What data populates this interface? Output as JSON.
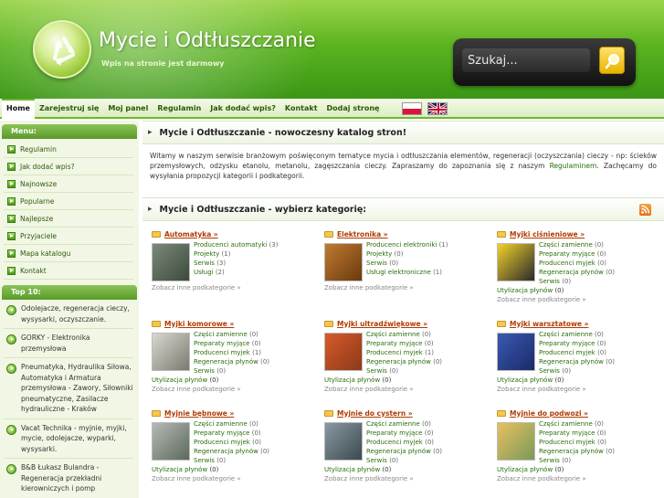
{
  "header": {
    "title": "Mycie i Odtłuszczanie",
    "subtitle": "Wpis na stronie jest darmowy",
    "search_placeholder": "Szukaj..."
  },
  "nav": {
    "items": [
      {
        "label": "Home"
      },
      {
        "label": "Zarejestruj się"
      },
      {
        "label": "Moj panel"
      },
      {
        "label": "Regulamin"
      },
      {
        "label": "Jak dodać wpis?"
      },
      {
        "label": "Kontakt"
      },
      {
        "label": "Dodaj stronę"
      }
    ]
  },
  "sidebar": {
    "menu_title": "Menu:",
    "menu": [
      {
        "label": "Regulamin"
      },
      {
        "label": "Jak dodać wpis?"
      },
      {
        "label": "Najnowsze"
      },
      {
        "label": "Popularne"
      },
      {
        "label": "Najlepsze"
      },
      {
        "label": "Przyjaciele"
      },
      {
        "label": "Mapa katalogu"
      },
      {
        "label": "Kontakt"
      }
    ],
    "top_title": "Top 10:",
    "top": [
      {
        "label": "Odolejacze, regeneracja cieczy, wysysarki, oczyszczanie."
      },
      {
        "label": "GORKY - Elektronika przemysłowa"
      },
      {
        "label": "Pneumatyka, Hydraulika Siłowa, Automatyka i Armatura przemysłowa - Zawory, Siłowniki pneumatyczne, Zasilacze hydrauliczne - Kraków"
      },
      {
        "label": "Vacat Technika - myjnie, myjki, mycie, odolejacze, wyparki, wysysarki."
      },
      {
        "label": "B&B Łukasz Bulandra - Regeneracja przekładni kierowniczych i pomp"
      }
    ]
  },
  "main": {
    "intro_title": "Mycie i Odtłuszczanie - nowoczesny katalog stron!",
    "intro_text_a": "Witamy w naszym serwisie branżowym poświęconym tematyce mycia i odtłuszczania elementów, regeneracji (oczyszczania) cieczy - np: ścieków przemysłowych, odzysku etanolu, metanolu, zagęszczania cieczy. Zapraszamy do zapoznania się z naszym ",
    "intro_link": "Regulaminem",
    "intro_text_b": ". Zachęcamy do wysyłania propozycji kategorii i podkategorii.",
    "cats_title": "Mycie i Odtłuszczanie - wybierz kategorię:",
    "more_label": "Zobacz inne podkategorie »",
    "categories": [
      {
        "title": "Automatyka »",
        "subs": [
          [
            "Producenci automatyki",
            "(3)"
          ],
          [
            "Projekty",
            "(1)"
          ],
          [
            "Serwis",
            "(3)"
          ],
          [
            "Usługi",
            "(2)"
          ]
        ],
        "after": []
      },
      {
        "title": "Elektronika »",
        "subs": [
          [
            "Producenci elektroniki",
            "(1)"
          ],
          [
            "Projekty",
            "(0)"
          ],
          [
            "Serwis",
            "(0)"
          ],
          [
            "Usługi elektroniczne",
            "(1)"
          ]
        ],
        "after": []
      },
      {
        "title": "Myjki ciśnieniowe »",
        "subs": [
          [
            "Części zamienne",
            "(0)"
          ],
          [
            "Preparaty myjące",
            "(0)"
          ],
          [
            "Producenci myjek",
            "(0)"
          ],
          [
            "Regeneracja płynów",
            "(0)"
          ],
          [
            "Serwis",
            "(0)"
          ]
        ],
        "after": [
          [
            "Utylizacja płynów",
            "(0)"
          ]
        ]
      },
      {
        "title": "Myjki komorowe »",
        "subs": [
          [
            "Części zamienne",
            "(0)"
          ],
          [
            "Preparaty myjące",
            "(0)"
          ],
          [
            "Producenci myjek",
            "(1)"
          ],
          [
            "Regeneracja płynów",
            "(0)"
          ],
          [
            "Serwis",
            "(0)"
          ]
        ],
        "after": [
          [
            "Utylizacja płynów",
            "(0)"
          ]
        ]
      },
      {
        "title": "Myjki ultradźwiękowe »",
        "subs": [
          [
            "Części zamienne",
            "(0)"
          ],
          [
            "Preparaty myjące",
            "(0)"
          ],
          [
            "Producenci myjek",
            "(1)"
          ],
          [
            "Regeneracja płynów",
            "(0)"
          ],
          [
            "Serwis",
            "(0)"
          ]
        ],
        "after": [
          [
            "Utylizacja płynów",
            "(0)"
          ]
        ]
      },
      {
        "title": "Myjki warsztatowe »",
        "subs": [
          [
            "Części zamienne",
            "(0)"
          ],
          [
            "Preparaty myjące",
            "(0)"
          ],
          [
            "Producenci myjek",
            "(0)"
          ],
          [
            "Regeneracja płynów",
            "(0)"
          ],
          [
            "Serwis",
            "(0)"
          ]
        ],
        "after": [
          [
            "Utylizacja płynów",
            "(0)"
          ]
        ]
      },
      {
        "title": "Myjnie bębnowe »",
        "subs": [
          [
            "Części zamienne",
            "(0)"
          ],
          [
            "Preparaty myjące",
            "(0)"
          ],
          [
            "Producenci myjek",
            "(0)"
          ],
          [
            "Regeneracja płynów",
            "(0)"
          ],
          [
            "Serwis",
            "(0)"
          ]
        ],
        "after": [
          [
            "Utylizacja płynów",
            "(0)"
          ]
        ]
      },
      {
        "title": "Myjnie do cystern »",
        "subs": [
          [
            "Części zamienne",
            "(0)"
          ],
          [
            "Preparaty myjące",
            "(0)"
          ],
          [
            "Producenci myjek",
            "(0)"
          ],
          [
            "Regeneracja płynów",
            "(0)"
          ],
          [
            "Serwis",
            "(0)"
          ]
        ],
        "after": [
          [
            "Utylizacja płynów",
            "(0)"
          ]
        ]
      },
      {
        "title": "Myjnie do podwozi »",
        "subs": [
          [
            "Części zamienne",
            "(0)"
          ],
          [
            "Preparaty myjące",
            "(0)"
          ],
          [
            "Producenci myjek",
            "(0)"
          ],
          [
            "Regeneracja płynów",
            "(0)"
          ],
          [
            "Serwis",
            "(0)"
          ]
        ],
        "after": [
          [
            "Utylizacja płynów",
            "(0)"
          ]
        ]
      }
    ]
  },
  "colors": {
    "brand_green": "#5cb421",
    "link_green": "#2a6e0a",
    "category_red": "#b23a00"
  },
  "icons": [
    "recycle-logo-icon",
    "search-icon",
    "flag-pl-icon",
    "flag-gb-icon",
    "rss-icon",
    "folder-icon",
    "arrow-bullet-icon"
  ]
}
